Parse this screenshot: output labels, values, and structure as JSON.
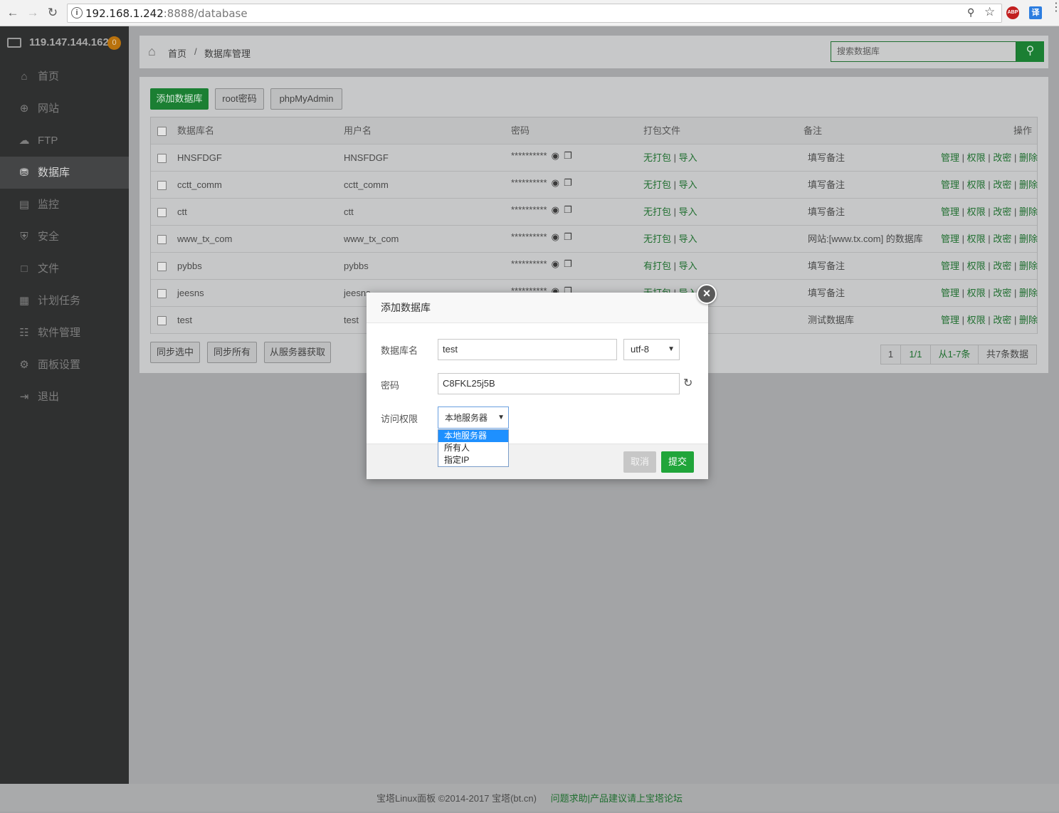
{
  "browser": {
    "url_host": "192.168.1.242",
    "url_path": ":8888/database",
    "ext_abp": "ABP",
    "ext_translate": "译"
  },
  "sidebar": {
    "server_ip": "119.147.144.162",
    "badge": "0",
    "items": [
      {
        "label": "首页",
        "icon": "home-icon"
      },
      {
        "label": "网站",
        "icon": "globe-icon"
      },
      {
        "label": "FTP",
        "icon": "ftp-icon"
      },
      {
        "label": "数据库",
        "icon": "database-icon"
      },
      {
        "label": "监控",
        "icon": "monitor-icon"
      },
      {
        "label": "安全",
        "icon": "shield-icon"
      },
      {
        "label": "文件",
        "icon": "folder-icon"
      },
      {
        "label": "计划任务",
        "icon": "calendar-icon"
      },
      {
        "label": "软件管理",
        "icon": "grid-icon"
      },
      {
        "label": "面板设置",
        "icon": "gear-icon"
      },
      {
        "label": "退出",
        "icon": "logout-icon"
      }
    ]
  },
  "breadcrumb": {
    "home": "首页",
    "sep": "/",
    "current": "数据库管理"
  },
  "search": {
    "placeholder": "搜索数据库"
  },
  "toolbar": {
    "add": "添加数据库",
    "root_pw": "root密码",
    "pma": "phpMyAdmin"
  },
  "table": {
    "headers": [
      "数据库名",
      "用户名",
      "密码",
      "打包文件",
      "备注",
      "操作"
    ],
    "rows": [
      {
        "name": "HNSFDGF",
        "user": "HNSFDGF",
        "pw": "**********",
        "pack": "无打包",
        "imp": "导入",
        "note": "填写备注"
      },
      {
        "name": "cctt_comm",
        "user": "cctt_comm",
        "pw": "**********",
        "pack": "无打包",
        "imp": "导入",
        "note": "填写备注"
      },
      {
        "name": "ctt",
        "user": "ctt",
        "pw": "**********",
        "pack": "无打包",
        "imp": "导入",
        "note": "填写备注"
      },
      {
        "name": "www_tx_com",
        "user": "www_tx_com",
        "pw": "**********",
        "pack": "无打包",
        "imp": "导入",
        "note": "网站:[www.tx.com] 的数据库"
      },
      {
        "name": "pybbs",
        "user": "pybbs",
        "pw": "**********",
        "pack": "有打包",
        "imp": "导入",
        "note": "填写备注"
      },
      {
        "name": "jeesns",
        "user": "jeesns",
        "pw": "**********",
        "pack": "无打包",
        "imp": "导入",
        "note": "填写备注"
      },
      {
        "name": "test",
        "user": "test",
        "pw": "",
        "pack": "",
        "imp": "",
        "note": "测试数据库"
      }
    ],
    "actions": {
      "manage": "管理",
      "perm": "权限",
      "change_pw": "改密",
      "delete": "删除",
      "sep": "|"
    }
  },
  "bottom_buttons": {
    "sync_selected": "同步选中",
    "sync_all": "同步所有",
    "fetch": "从服务器获取"
  },
  "pager": {
    "page": "1",
    "pages": "1/1",
    "range": "从1-7条",
    "total": "共7条数据"
  },
  "footer": {
    "copyright": "宝塔Linux面板 ©2014-2017 宝塔(bt.cn)",
    "link": "问题求助|产品建议请上宝塔论坛"
  },
  "modal": {
    "title": "添加数据库",
    "name_label": "数据库名",
    "name_value": "test",
    "charset": "utf-8",
    "pw_label": "密码",
    "pw_value": "C8FKL25j5B",
    "access_label": "访问权限",
    "access_value": "本地服务器",
    "access_options": [
      "本地服务器",
      "所有人",
      "指定IP"
    ],
    "cancel": "取消",
    "submit": "提交"
  }
}
